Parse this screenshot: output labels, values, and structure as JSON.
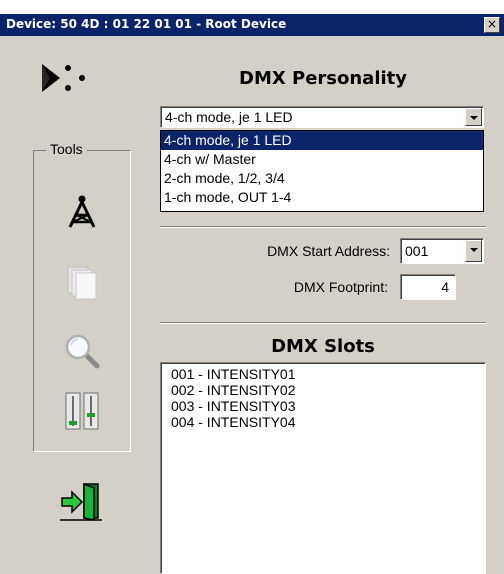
{
  "window": {
    "title": "Device: 50 4D : 01 22 01 01 - Root Device",
    "close_label": "×"
  },
  "personality": {
    "heading": "DMX Personality",
    "selected": "4-ch mode, je 1 LED",
    "options": [
      "4-ch mode, je 1 LED",
      "4-ch w/ Master",
      "2-ch mode, 1/2, 3/4",
      "1-ch mode, OUT 1-4"
    ],
    "highlighted_index": 0
  },
  "tools": {
    "legend": "Tools",
    "icons": [
      "antenna-icon",
      "pages-icon",
      "magnifier-icon",
      "faders-icon"
    ]
  },
  "start_address": {
    "label": "DMX Start Address:",
    "value": "001"
  },
  "footprint": {
    "label": "DMX Footprint:",
    "value": "4"
  },
  "slots": {
    "heading": "DMX Slots",
    "items": [
      "001 - INTENSITY01",
      "002 - INTENSITY02",
      "003 - INTENSITY03",
      "004 - INTENSITY04"
    ]
  },
  "colors": {
    "titlebar": "#0a246a",
    "selection": "#0a246a",
    "face": "#d4d0c8"
  }
}
